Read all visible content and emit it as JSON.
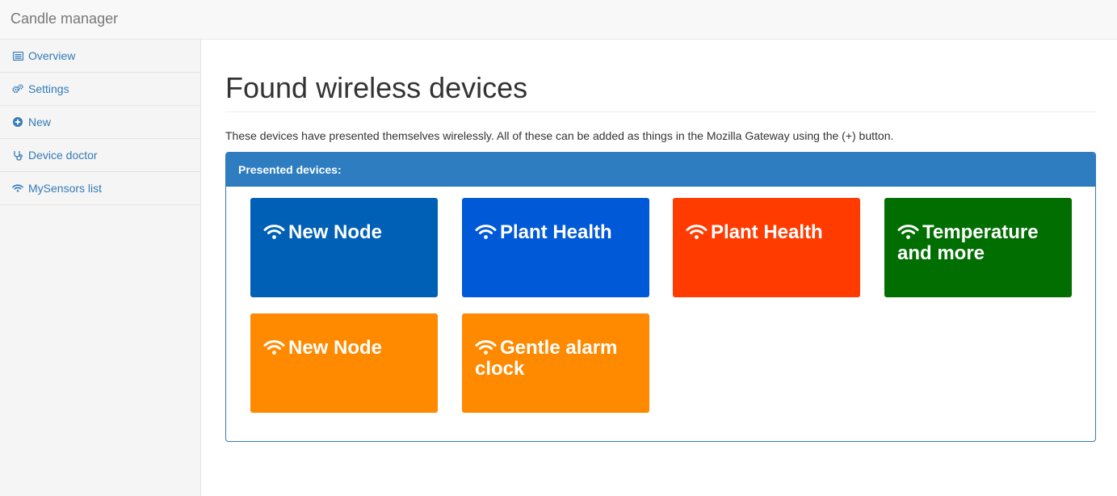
{
  "app": {
    "title": "Candle manager"
  },
  "sidebar": {
    "items": [
      {
        "label": "Overview",
        "icon": "list-icon"
      },
      {
        "label": "Settings",
        "icon": "gears-icon"
      },
      {
        "label": "New",
        "icon": "plus-circle-icon"
      },
      {
        "label": "Device doctor",
        "icon": "stethoscope-icon"
      },
      {
        "label": "MySensors list",
        "icon": "wifi-icon"
      }
    ]
  },
  "main": {
    "title": "Found wireless devices",
    "intro": "These devices have presented themselves wirelessly. All of these can be added as things in the Mozilla Gateway using the (+) button.",
    "panel": {
      "heading": "Presented devices:",
      "devices": [
        {
          "name": "New Node",
          "color": "#0060b6",
          "icon": "wifi-icon"
        },
        {
          "name": "Plant Health",
          "color": "#0059d6",
          "icon": "wifi-icon"
        },
        {
          "name": "Plant Health",
          "color": "#ff3b00",
          "icon": "wifi-icon"
        },
        {
          "name": "Temperature and more",
          "color": "#006e00",
          "icon": "wifi-icon"
        },
        {
          "name": "New Node",
          "color": "#ff8a00",
          "icon": "wifi-icon"
        },
        {
          "name": "Gentle alarm clock",
          "color": "#ff8a00",
          "icon": "wifi-icon"
        }
      ]
    }
  },
  "colors": {
    "accent": "#337ab7",
    "panel_heading": "#2d7dc0"
  }
}
